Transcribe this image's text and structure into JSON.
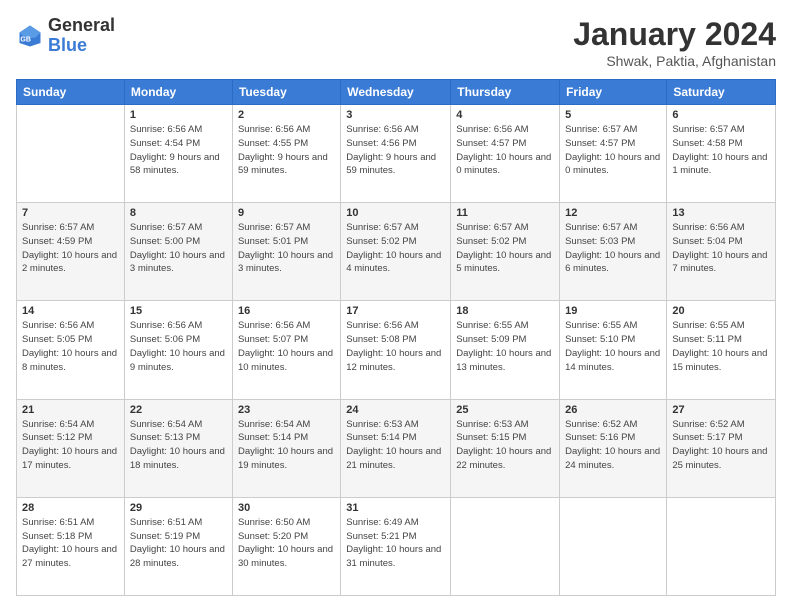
{
  "logo": {
    "text_general": "General",
    "text_blue": "Blue"
  },
  "title": "January 2024",
  "subtitle": "Shwak, Paktia, Afghanistan",
  "header_days": [
    "Sunday",
    "Monday",
    "Tuesday",
    "Wednesday",
    "Thursday",
    "Friday",
    "Saturday"
  ],
  "weeks": [
    [
      {
        "day": "",
        "sunrise": "",
        "sunset": "",
        "daylight": ""
      },
      {
        "day": "1",
        "sunrise": "Sunrise: 6:56 AM",
        "sunset": "Sunset: 4:54 PM",
        "daylight": "Daylight: 9 hours and 58 minutes."
      },
      {
        "day": "2",
        "sunrise": "Sunrise: 6:56 AM",
        "sunset": "Sunset: 4:55 PM",
        "daylight": "Daylight: 9 hours and 59 minutes."
      },
      {
        "day": "3",
        "sunrise": "Sunrise: 6:56 AM",
        "sunset": "Sunset: 4:56 PM",
        "daylight": "Daylight: 9 hours and 59 minutes."
      },
      {
        "day": "4",
        "sunrise": "Sunrise: 6:56 AM",
        "sunset": "Sunset: 4:57 PM",
        "daylight": "Daylight: 10 hours and 0 minutes."
      },
      {
        "day": "5",
        "sunrise": "Sunrise: 6:57 AM",
        "sunset": "Sunset: 4:57 PM",
        "daylight": "Daylight: 10 hours and 0 minutes."
      },
      {
        "day": "6",
        "sunrise": "Sunrise: 6:57 AM",
        "sunset": "Sunset: 4:58 PM",
        "daylight": "Daylight: 10 hours and 1 minute."
      }
    ],
    [
      {
        "day": "7",
        "sunrise": "Sunrise: 6:57 AM",
        "sunset": "Sunset: 4:59 PM",
        "daylight": "Daylight: 10 hours and 2 minutes."
      },
      {
        "day": "8",
        "sunrise": "Sunrise: 6:57 AM",
        "sunset": "Sunset: 5:00 PM",
        "daylight": "Daylight: 10 hours and 3 minutes."
      },
      {
        "day": "9",
        "sunrise": "Sunrise: 6:57 AM",
        "sunset": "Sunset: 5:01 PM",
        "daylight": "Daylight: 10 hours and 3 minutes."
      },
      {
        "day": "10",
        "sunrise": "Sunrise: 6:57 AM",
        "sunset": "Sunset: 5:02 PM",
        "daylight": "Daylight: 10 hours and 4 minutes."
      },
      {
        "day": "11",
        "sunrise": "Sunrise: 6:57 AM",
        "sunset": "Sunset: 5:02 PM",
        "daylight": "Daylight: 10 hours and 5 minutes."
      },
      {
        "day": "12",
        "sunrise": "Sunrise: 6:57 AM",
        "sunset": "Sunset: 5:03 PM",
        "daylight": "Daylight: 10 hours and 6 minutes."
      },
      {
        "day": "13",
        "sunrise": "Sunrise: 6:56 AM",
        "sunset": "Sunset: 5:04 PM",
        "daylight": "Daylight: 10 hours and 7 minutes."
      }
    ],
    [
      {
        "day": "14",
        "sunrise": "Sunrise: 6:56 AM",
        "sunset": "Sunset: 5:05 PM",
        "daylight": "Daylight: 10 hours and 8 minutes."
      },
      {
        "day": "15",
        "sunrise": "Sunrise: 6:56 AM",
        "sunset": "Sunset: 5:06 PM",
        "daylight": "Daylight: 10 hours and 9 minutes."
      },
      {
        "day": "16",
        "sunrise": "Sunrise: 6:56 AM",
        "sunset": "Sunset: 5:07 PM",
        "daylight": "Daylight: 10 hours and 10 minutes."
      },
      {
        "day": "17",
        "sunrise": "Sunrise: 6:56 AM",
        "sunset": "Sunset: 5:08 PM",
        "daylight": "Daylight: 10 hours and 12 minutes."
      },
      {
        "day": "18",
        "sunrise": "Sunrise: 6:55 AM",
        "sunset": "Sunset: 5:09 PM",
        "daylight": "Daylight: 10 hours and 13 minutes."
      },
      {
        "day": "19",
        "sunrise": "Sunrise: 6:55 AM",
        "sunset": "Sunset: 5:10 PM",
        "daylight": "Daylight: 10 hours and 14 minutes."
      },
      {
        "day": "20",
        "sunrise": "Sunrise: 6:55 AM",
        "sunset": "Sunset: 5:11 PM",
        "daylight": "Daylight: 10 hours and 15 minutes."
      }
    ],
    [
      {
        "day": "21",
        "sunrise": "Sunrise: 6:54 AM",
        "sunset": "Sunset: 5:12 PM",
        "daylight": "Daylight: 10 hours and 17 minutes."
      },
      {
        "day": "22",
        "sunrise": "Sunrise: 6:54 AM",
        "sunset": "Sunset: 5:13 PM",
        "daylight": "Daylight: 10 hours and 18 minutes."
      },
      {
        "day": "23",
        "sunrise": "Sunrise: 6:54 AM",
        "sunset": "Sunset: 5:14 PM",
        "daylight": "Daylight: 10 hours and 19 minutes."
      },
      {
        "day": "24",
        "sunrise": "Sunrise: 6:53 AM",
        "sunset": "Sunset: 5:14 PM",
        "daylight": "Daylight: 10 hours and 21 minutes."
      },
      {
        "day": "25",
        "sunrise": "Sunrise: 6:53 AM",
        "sunset": "Sunset: 5:15 PM",
        "daylight": "Daylight: 10 hours and 22 minutes."
      },
      {
        "day": "26",
        "sunrise": "Sunrise: 6:52 AM",
        "sunset": "Sunset: 5:16 PM",
        "daylight": "Daylight: 10 hours and 24 minutes."
      },
      {
        "day": "27",
        "sunrise": "Sunrise: 6:52 AM",
        "sunset": "Sunset: 5:17 PM",
        "daylight": "Daylight: 10 hours and 25 minutes."
      }
    ],
    [
      {
        "day": "28",
        "sunrise": "Sunrise: 6:51 AM",
        "sunset": "Sunset: 5:18 PM",
        "daylight": "Daylight: 10 hours and 27 minutes."
      },
      {
        "day": "29",
        "sunrise": "Sunrise: 6:51 AM",
        "sunset": "Sunset: 5:19 PM",
        "daylight": "Daylight: 10 hours and 28 minutes."
      },
      {
        "day": "30",
        "sunrise": "Sunrise: 6:50 AM",
        "sunset": "Sunset: 5:20 PM",
        "daylight": "Daylight: 10 hours and 30 minutes."
      },
      {
        "day": "31",
        "sunrise": "Sunrise: 6:49 AM",
        "sunset": "Sunset: 5:21 PM",
        "daylight": "Daylight: 10 hours and 31 minutes."
      },
      {
        "day": "",
        "sunrise": "",
        "sunset": "",
        "daylight": ""
      },
      {
        "day": "",
        "sunrise": "",
        "sunset": "",
        "daylight": ""
      },
      {
        "day": "",
        "sunrise": "",
        "sunset": "",
        "daylight": ""
      }
    ]
  ]
}
